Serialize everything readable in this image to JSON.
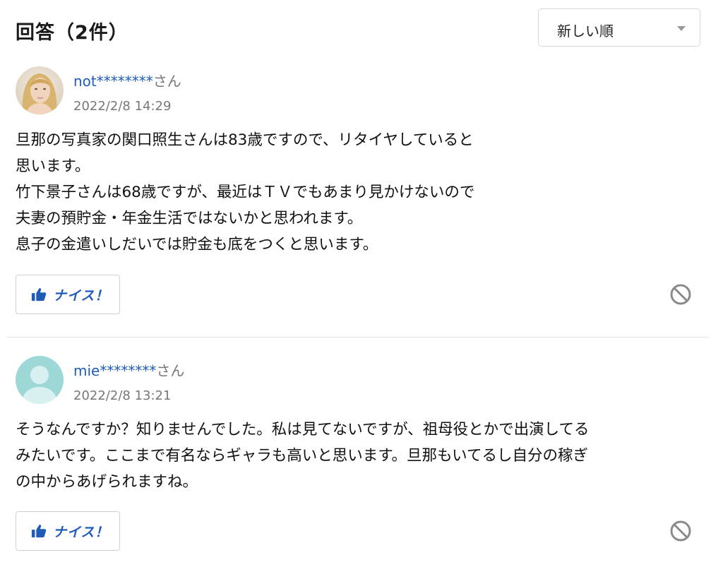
{
  "header": {
    "title": "回答（2件）",
    "sort_label": "新しい順"
  },
  "answers": [
    {
      "username": "not********",
      "honorific": "さん",
      "date": "2022/2/8 14:29",
      "avatar": "photo-avatar",
      "lines": [
        "旦那の写真家の関口照生さんは83歳ですので、リタイヤしていると",
        "思います。",
        "竹下景子さんは68歳ですが、最近はＴＶでもあまり見かけないので",
        "夫妻の預貯金・年金生活ではないかと思われます。",
        "息子の金遣いしだいでは貯金も底をつくと思います。"
      ],
      "nice_label": "ナイス！"
    },
    {
      "username": "mie********",
      "honorific": "さん",
      "date": "2022/2/8 13:21",
      "avatar": "default-avatar",
      "lines": [
        "そうなんですか？知りませんでした。私は見てないですが、祖母役とかで出演してる",
        "みたいです。ここまで有名ならギャラも高いと思います。旦那もいてるし自分の稼ぎ",
        "の中からあげられますね。"
      ],
      "nice_label": "ナイス！"
    }
  ],
  "icons": {
    "nice": "thumbs-up-icon",
    "block": "block-icon"
  },
  "colors": {
    "link_blue": "#1f5bb8",
    "muted_gray": "#777777",
    "default_avatar_teal": "#9dd8d6"
  }
}
